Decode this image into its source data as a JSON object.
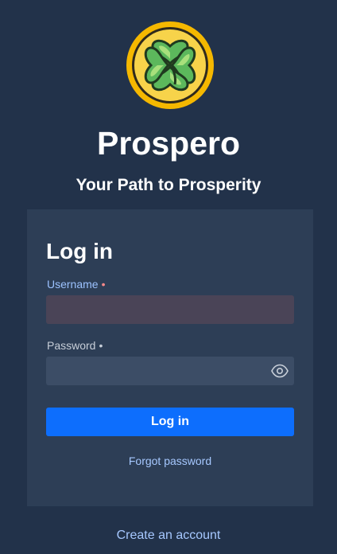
{
  "brand": {
    "name": "Prospero",
    "tagline": "Your Path to Prosperity",
    "logo_icon": "four-leaf-clover-coin-icon",
    "logo_colors": {
      "ring": "#f5b800",
      "face": "#f7d34a",
      "clover": "#5cb85c",
      "edge": "#2f2a1c"
    }
  },
  "login": {
    "title": "Log in",
    "username_label": "Username",
    "username_value": "",
    "password_label": "Password",
    "password_value": "",
    "required_marker": "•",
    "show_password_icon": "eye-icon",
    "submit_label": "Log in",
    "forgot_label": "Forgot password"
  },
  "footer": {
    "create_account_label": "Create an account"
  },
  "colors": {
    "background": "#22324a",
    "card": "#2d3e56",
    "primary": "#0d6efd",
    "link": "#a6c8ff",
    "invalid_field": "#4a4457"
  }
}
